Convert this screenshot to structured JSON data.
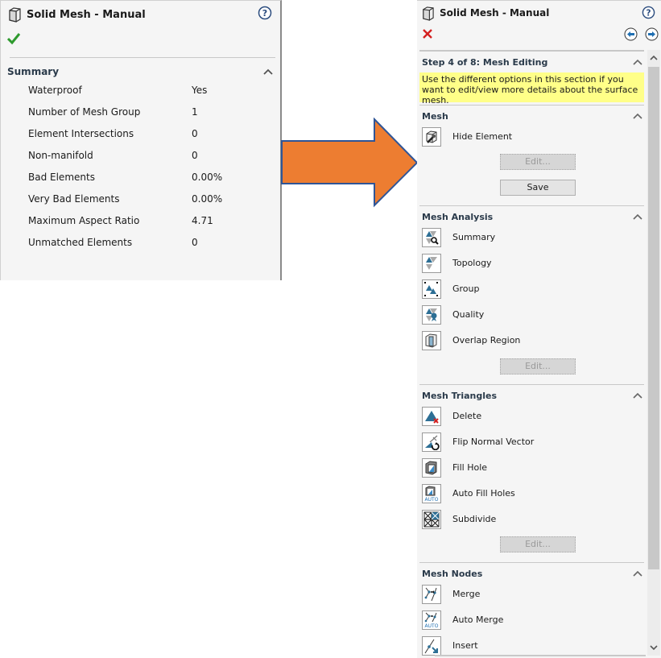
{
  "left_panel": {
    "title": "Solid Mesh - Manual",
    "title_icon": "solid-part-icon",
    "help_icon": "help-icon",
    "ok_icon": "checkmark-icon",
    "summary": {
      "title": "Summary",
      "rows": [
        {
          "label": "Waterproof",
          "value": "Yes"
        },
        {
          "label": "Number of Mesh Group",
          "value": "1"
        },
        {
          "label": "Element Intersections",
          "value": "0"
        },
        {
          "label": "Non-manifold",
          "value": "0"
        },
        {
          "label": "Bad Elements",
          "value": "0.00%"
        },
        {
          "label": "Very Bad Elements",
          "value": "0.00%"
        },
        {
          "label": "Maximum Aspect Ratio",
          "value": "4.71"
        },
        {
          "label": "Unmatched Elements",
          "value": "0"
        }
      ]
    }
  },
  "arrow": {
    "color": "#ed7d31",
    "stroke": "#2f5597"
  },
  "right_panel": {
    "title": "Solid Mesh - Manual",
    "title_icon": "solid-part-icon",
    "help_icon": "help-icon",
    "cancel_icon": "close-icon",
    "nav": {
      "back_icon": "arrow-left-icon",
      "next_icon": "arrow-right-icon"
    },
    "step": {
      "title": "Step 4 of 8: Mesh Editing",
      "message": "Use the different options in this section if you want to edit/view more details about the surface mesh."
    },
    "sections": {
      "mesh": {
        "title": "Mesh",
        "items": [
          {
            "label": "Hide Element",
            "icon": "hide-element-icon"
          }
        ],
        "edit_label": "Edit...",
        "save_label": "Save"
      },
      "analysis": {
        "title": "Mesh Analysis",
        "items": [
          {
            "label": "Summary",
            "icon": "summary-icon"
          },
          {
            "label": "Topology",
            "icon": "topology-icon"
          },
          {
            "label": "Group",
            "icon": "group-icon"
          },
          {
            "label": "Quality",
            "icon": "quality-icon"
          },
          {
            "label": "Overlap Region",
            "icon": "overlap-region-icon"
          }
        ],
        "edit_label": "Edit..."
      },
      "triangles": {
        "title": "Mesh Triangles",
        "items": [
          {
            "label": "Delete",
            "icon": "delete-triangle-icon"
          },
          {
            "label": "Flip Normal Vector",
            "icon": "flip-normal-icon"
          },
          {
            "label": "Fill Hole",
            "icon": "fill-hole-icon"
          },
          {
            "label": "Auto Fill Holes",
            "icon": "auto-fill-holes-icon"
          },
          {
            "label": "Subdivide",
            "icon": "subdivide-icon"
          }
        ],
        "edit_label": "Edit..."
      },
      "nodes": {
        "title": "Mesh Nodes",
        "items": [
          {
            "label": "Merge",
            "icon": "merge-icon"
          },
          {
            "label": "Auto Merge",
            "icon": "auto-merge-icon"
          },
          {
            "label": "Insert",
            "icon": "insert-node-icon"
          }
        ]
      }
    }
  }
}
